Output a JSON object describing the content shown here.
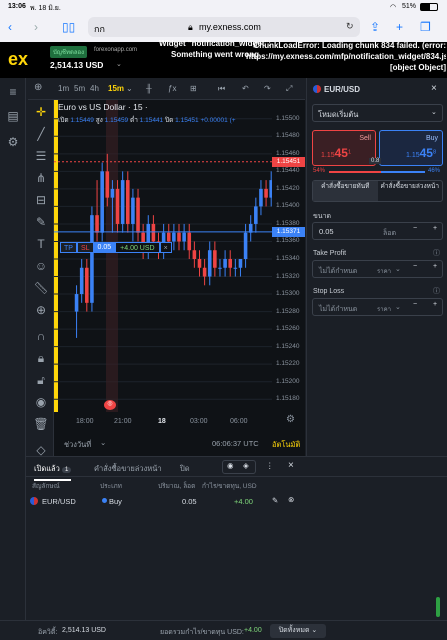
{
  "status": {
    "time": "13:06",
    "date": "พ. 18 มิ.ย.",
    "battery": "51%"
  },
  "safari": {
    "aa": "กก",
    "url": "my.exness.com"
  },
  "header": {
    "logo": "ex",
    "account_badge": "บัญชีทดลอง",
    "account_server": "forexonapp.com",
    "balance": "2,514.13 USD",
    "widget_error": "Widget \"notification_widget\": Something went wrong",
    "chunk_error": "ChunkLoadError: Loading chunk 834 failed. (error: https://my.exness.com/mfp/notification_widget/834.js) [object Object]"
  },
  "chart_toolbar": {
    "timeframes": [
      "1m",
      "5m",
      "4h",
      "15m"
    ],
    "active": "15m"
  },
  "chart": {
    "title": "Euro vs US Dollar · 15 ·",
    "ohlc_labels": {
      "o": "เปิด",
      "h": "สูง",
      "l": "ต่ำ",
      "c": "ปิด"
    },
    "ohlc": {
      "o": "1.15449",
      "h": "1.15459",
      "l": "1.15441",
      "c": "1.15451",
      "chg": "+0.00001 (+"
    },
    "current_price": "1.15451",
    "position_price": "1.15371",
    "position_bar": {
      "tp": "TP",
      "sl": "SL",
      "lots": "0.05",
      "pnl": "+4.00 USD",
      "close": "×"
    },
    "price_ticks": [
      "1.15500",
      "1.15480",
      "1.15460",
      "1.15440",
      "1.15420",
      "1.15400",
      "1.15380",
      "1.15360",
      "1.15340",
      "1.15320",
      "1.15300",
      "1.15280",
      "1.15260",
      "1.15240",
      "1.15220",
      "1.15200",
      "1.15180"
    ],
    "time_ticks": [
      "18:00",
      "21:00",
      "18",
      "03:00",
      "06:00"
    ],
    "range_label": "ช่วงวันที่",
    "clock": "06:06:37 UTC",
    "auto_label": "อัตโนมัติ"
  },
  "chart_data": {
    "type": "candlestick",
    "ylim": [
      1.1517,
      1.1551
    ],
    "x_ticks": [
      "18:00",
      "21:00",
      "18",
      "03:00",
      "06:00"
    ],
    "candles": [
      [
        1.1528,
        1.1531,
        1.1525,
        1.153
      ],
      [
        1.153,
        1.1534,
        1.1529,
        1.1533
      ],
      [
        1.1533,
        1.1534,
        1.1528,
        1.1529
      ],
      [
        1.1529,
        1.154,
        1.1528,
        1.1539
      ],
      [
        1.1539,
        1.1543,
        1.1536,
        1.1537
      ],
      [
        1.1537,
        1.1545,
        1.1536,
        1.1544
      ],
      [
        1.1544,
        1.1546,
        1.154,
        1.1541
      ],
      [
        1.1541,
        1.1543,
        1.1537,
        1.1542
      ],
      [
        1.1542,
        1.1543,
        1.1537,
        1.1538
      ],
      [
        1.1538,
        1.1544,
        1.1537,
        1.1543
      ],
      [
        1.1543,
        1.1544,
        1.1537,
        1.1538
      ],
      [
        1.1538,
        1.1542,
        1.1536,
        1.1541
      ],
      [
        1.1541,
        1.1542,
        1.1536,
        1.1537
      ],
      [
        1.1537,
        1.1538,
        1.1534,
        1.1535
      ],
      [
        1.1535,
        1.1539,
        1.1534,
        1.1538
      ],
      [
        1.1538,
        1.1539,
        1.1535,
        1.1536
      ],
      [
        1.1536,
        1.1537,
        1.1534,
        1.1535
      ],
      [
        1.1535,
        1.1538,
        1.1534,
        1.1537
      ],
      [
        1.1537,
        1.1538,
        1.1535,
        1.1536
      ],
      [
        1.1536,
        1.1538,
        1.1535,
        1.1537
      ],
      [
        1.1537,
        1.1538,
        1.1535,
        1.1536
      ],
      [
        1.1536,
        1.1538,
        1.1535,
        1.1537
      ],
      [
        1.1537,
        1.1538,
        1.1534,
        1.1535
      ],
      [
        1.1535,
        1.1536,
        1.1533,
        1.1534
      ],
      [
        1.1534,
        1.1535,
        1.1532,
        1.1533
      ],
      [
        1.1533,
        1.1534,
        1.1531,
        1.1532
      ],
      [
        1.1532,
        1.1536,
        1.1531,
        1.1535
      ],
      [
        1.1535,
        1.1536,
        1.1532,
        1.1533
      ],
      [
        1.1533,
        1.1534,
        1.1532,
        1.1533
      ],
      [
        1.1533,
        1.1535,
        1.1532,
        1.1534
      ],
      [
        1.1534,
        1.1535,
        1.1532,
        1.1533
      ],
      [
        1.1533,
        1.1534,
        1.1532,
        1.1533
      ],
      [
        1.1533,
        1.1534,
        1.1532,
        1.1534
      ],
      [
        1.1534,
        1.1538,
        1.1533,
        1.1537
      ],
      [
        1.1537,
        1.1539,
        1.1536,
        1.1538
      ],
      [
        1.1538,
        1.1541,
        1.1537,
        1.154
      ],
      [
        1.154,
        1.1543,
        1.1539,
        1.1542
      ],
      [
        1.1542,
        1.1543,
        1.154,
        1.1541
      ],
      [
        1.1541,
        1.1544,
        1.154,
        1.1543
      ],
      [
        1.1543,
        1.1545,
        1.1542,
        1.1544
      ],
      [
        1.1544,
        1.1546,
        1.1543,
        1.1545
      ]
    ]
  },
  "order": {
    "symbol": "EUR/USD",
    "mode": "โหมดเริ่มต้น",
    "sell_label": "Sell",
    "sell_price_main": "1.15",
    "sell_price_big": "45",
    "sell_price_sup": "1",
    "buy_label": "Buy",
    "buy_price_main": "1.15",
    "buy_price_big": "45",
    "buy_price_sup": "8",
    "spread": "0.8",
    "sell_pct": "54%",
    "buy_pct": "46%",
    "market_tab": "คำสั่งซื้อขายทันที",
    "pending_tab": "คำสั่งซื้อขายล่วงหน้า",
    "size_label": "ขนาด",
    "size_value": "0.05",
    "size_unit": "ล็อต",
    "tp_label": "Take Profit",
    "tp_placeholder": "ไม่ได้กำหนด",
    "tp_unit": "ราคา",
    "sl_label": "Stop Loss",
    "sl_placeholder": "ไม่ได้กำหนด",
    "sl_unit": "ราคา"
  },
  "positions": {
    "tabs": [
      "เปิดแล้ว",
      "คำสั่งซื้อขายล่วงหน้า",
      "ปิด"
    ],
    "open_count": "1",
    "headers": [
      "สัญลักษณ์",
      "ประเภท",
      "ปริมาณ, ล็อต",
      "กำไร/ขาดทุน, USD"
    ],
    "rows": [
      {
        "symbol": "EUR/USD",
        "type": "Buy",
        "volume": "0.05",
        "pnl": "+4.00"
      }
    ]
  },
  "footer": {
    "equity_label": "อิควิตี้:",
    "equity": "2,514.13 USD",
    "pnl_label": "ยอดรวมกำไร/ขาดทุน USD:",
    "pnl": "+4.00",
    "close_all": "ปิดทั้งหมด"
  },
  "colors": {
    "up": "#3b82f6",
    "down": "#ef4444",
    "accent": "#ffd60a",
    "buy": "#3b82f6",
    "sell": "#ef4444"
  }
}
